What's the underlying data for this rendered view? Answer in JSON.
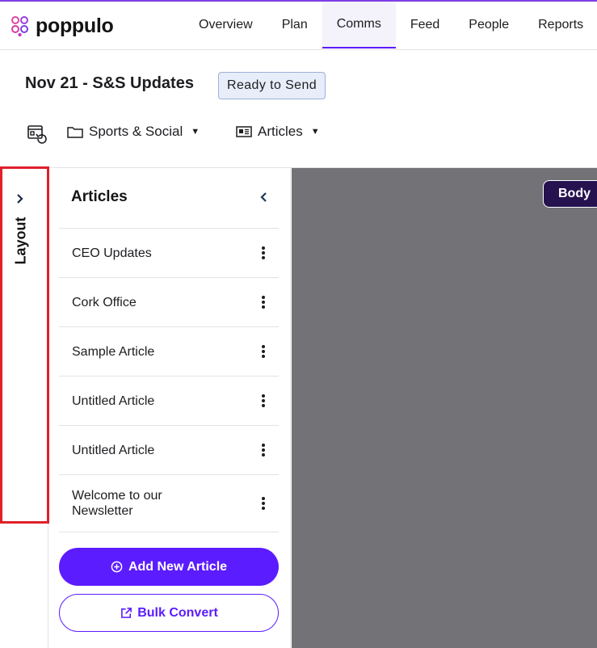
{
  "app": {
    "logo_text": "poppulo"
  },
  "nav": {
    "items": [
      {
        "label": "Overview"
      },
      {
        "label": "Plan"
      },
      {
        "label": "Comms"
      },
      {
        "label": "Feed"
      },
      {
        "label": "People"
      },
      {
        "label": "Reports"
      }
    ],
    "active": "Comms"
  },
  "header": {
    "title": "Nov 21 - S&S Updates",
    "status": "Ready to Send"
  },
  "toolbar": {
    "section_label": "Sports & Social",
    "view_label": "Articles"
  },
  "layout_panel": {
    "label": "Layout"
  },
  "articles_panel": {
    "title": "Articles",
    "items": [
      {
        "name": "CEO Updates"
      },
      {
        "name": "Cork Office"
      },
      {
        "name": "Sample Article"
      },
      {
        "name": "Untitled Article"
      },
      {
        "name": "Untitled Article"
      },
      {
        "name": "Welcome to our Newsletter"
      }
    ],
    "add_button": "Add New Article",
    "bulk_button": "Bulk Convert"
  },
  "canvas": {
    "section_tag": "Body"
  },
  "colors": {
    "accent": "#5b1cff",
    "highlight_border": "#e0202a",
    "canvas_bg": "#737377",
    "tag_bg": "#26124f",
    "badge_bg": "#e8eef9"
  }
}
